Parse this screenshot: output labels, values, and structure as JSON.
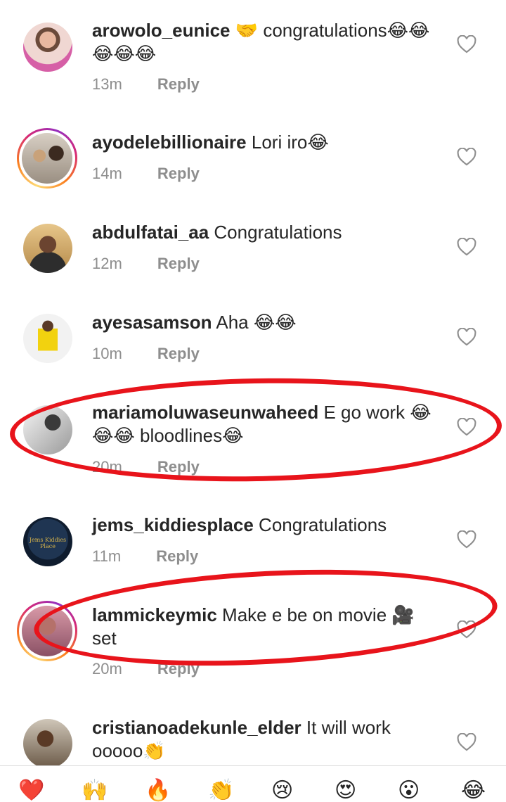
{
  "comments": [
    {
      "username": "arowolo_eunice",
      "text": "🤝 congratulations😂😂😂😂😂",
      "time": "13m",
      "reply": "Reply",
      "story": false
    },
    {
      "username": "ayodelebillionaire",
      "text": "Lori iro😂",
      "time": "14m",
      "reply": "Reply",
      "story": true
    },
    {
      "username": "abdulfatai_aa",
      "text": "Congratulations",
      "time": "12m",
      "reply": "Reply",
      "story": false
    },
    {
      "username": "ayesasamson",
      "text": "Aha 😂😂",
      "time": "10m",
      "reply": "Reply",
      "story": false
    },
    {
      "username": "mariamoluwaseunwaheed",
      "text": "E go work 😂😂😂 bloodlines😂",
      "time": "20m",
      "reply": "Reply",
      "story": false
    },
    {
      "username": "jems_kiddiesplace",
      "text": "Congratulations",
      "time": "11m",
      "reply": "Reply",
      "story": false
    },
    {
      "username": "lammickeymic",
      "text": "Make e be on movie 🎥 set",
      "time": "20m",
      "reply": "Reply",
      "story": true
    },
    {
      "username": "cristianoadekunle_elder",
      "text": "It will work ooooo👏",
      "time": "",
      "reply": "",
      "story": false
    }
  ],
  "avatar_logo_text": "Jems Kiddies Place",
  "reactions": [
    "❤️",
    "🙌",
    "🔥",
    "👏",
    "😢",
    "😍",
    "😮",
    "😂"
  ],
  "colors": {
    "annotation": "#e8141b",
    "meta": "#8e8e8e"
  }
}
